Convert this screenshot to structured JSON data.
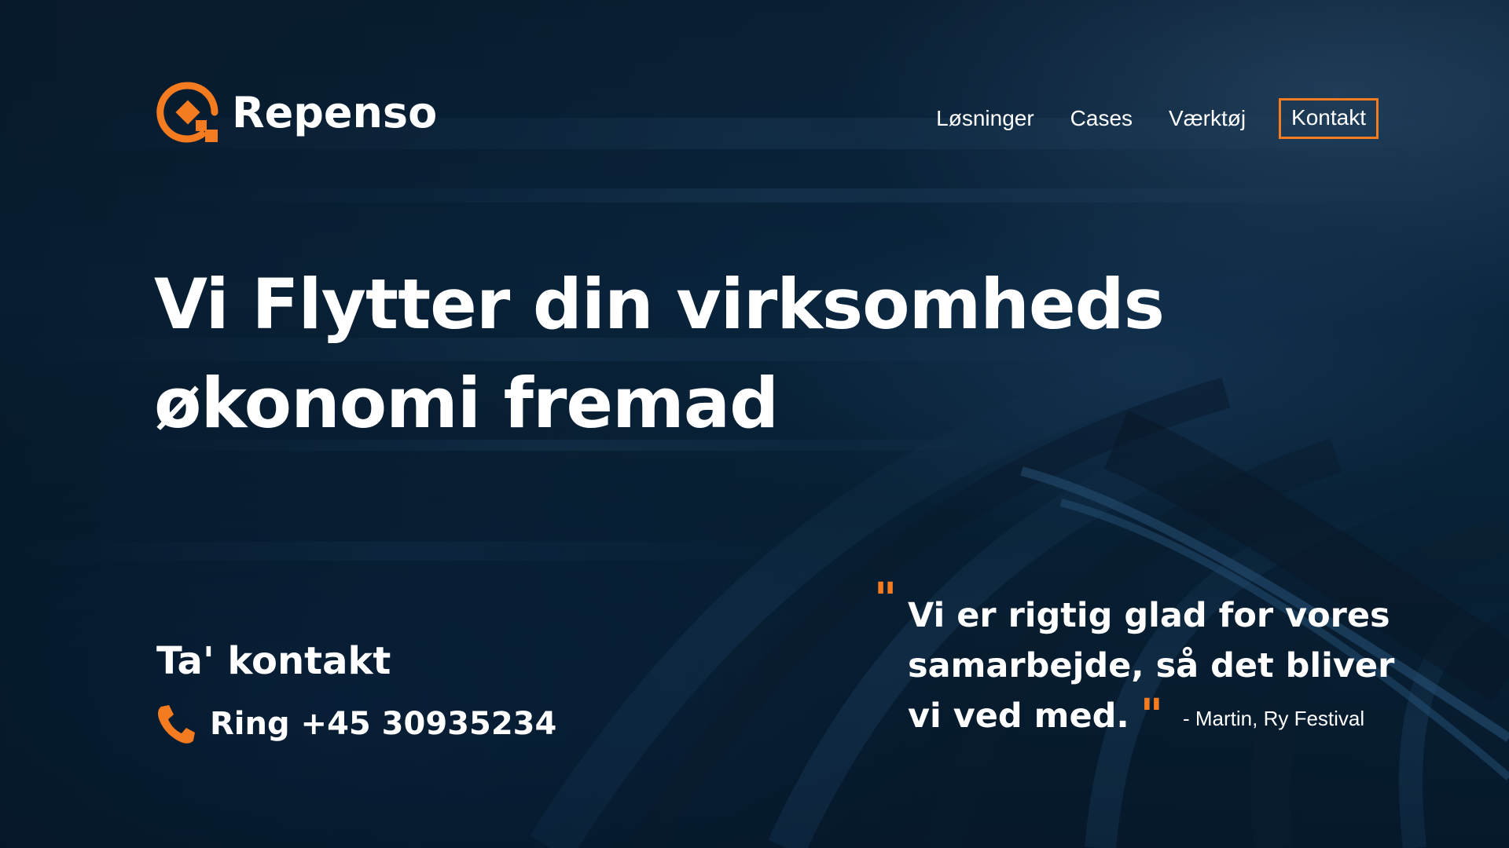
{
  "brand": {
    "name": "Repenso",
    "accent_color": "#f47b20",
    "background_color": "#0a2740"
  },
  "nav": {
    "items": [
      {
        "label": "Løsninger"
      },
      {
        "label": "Cases"
      },
      {
        "label": "Værktøj"
      }
    ],
    "contact_label": "Kontakt"
  },
  "hero": {
    "headline": "Vi Flytter din virksomheds økonomi fremad"
  },
  "contact": {
    "title": "Ta' kontakt",
    "phone_label": "Ring +45 30935234",
    "icon": "phone-icon"
  },
  "testimonial": {
    "open_mark": "\"",
    "text": "Vi er rigtig glad for vores samarbejde, så det bliver vi ved med.",
    "close_mark": "\"",
    "author": "- Martin, Ry Festival"
  }
}
